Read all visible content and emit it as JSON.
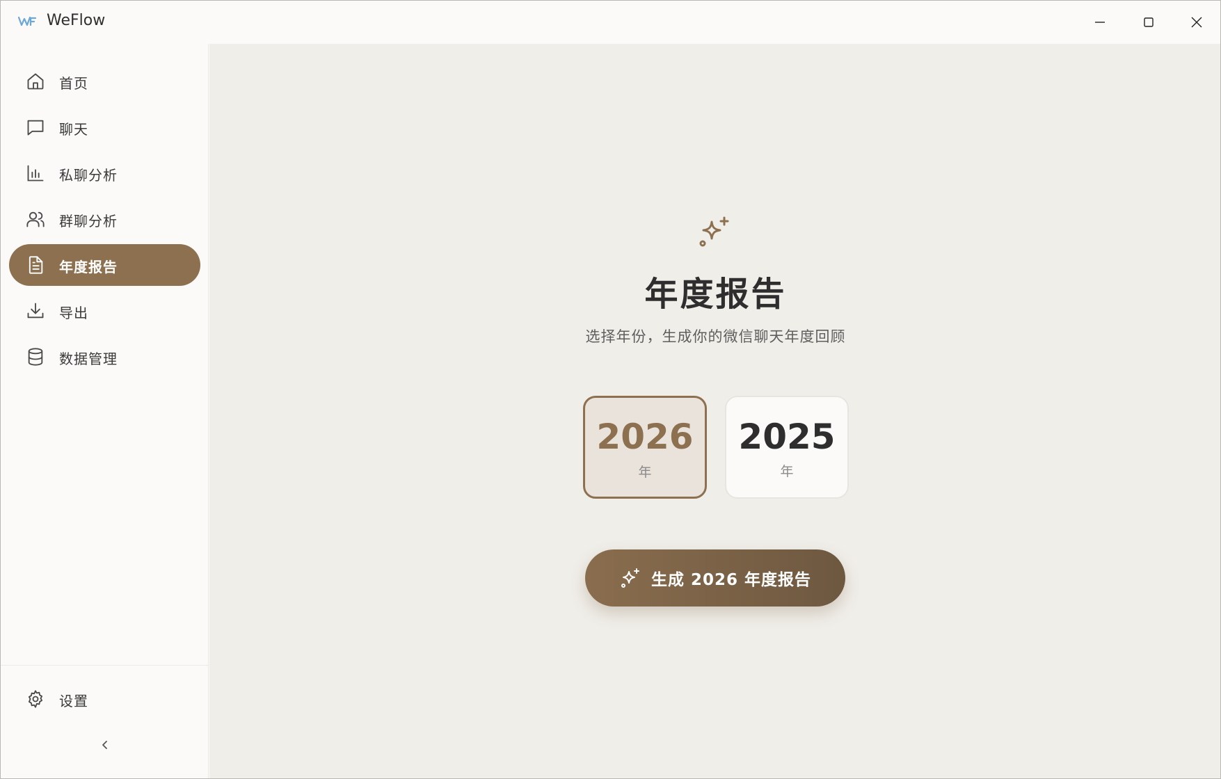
{
  "app": {
    "title": "WeFlow",
    "brand_color": "#8c7050"
  },
  "window_controls": {
    "minimize": "minimize-icon",
    "maximize": "maximize-icon",
    "close": "close-icon"
  },
  "sidebar": {
    "items": [
      {
        "label": "首页",
        "icon": "home-icon",
        "active": false
      },
      {
        "label": "聊天",
        "icon": "chat-icon",
        "active": false
      },
      {
        "label": "私聊分析",
        "icon": "bar-chart-icon",
        "active": false
      },
      {
        "label": "群聊分析",
        "icon": "users-icon",
        "active": false
      },
      {
        "label": "年度报告",
        "icon": "document-icon",
        "active": true
      },
      {
        "label": "导出",
        "icon": "download-icon",
        "active": false
      },
      {
        "label": "数据管理",
        "icon": "database-icon",
        "active": false
      }
    ],
    "settings": {
      "label": "设置",
      "icon": "gear-icon"
    },
    "collapse_icon": "chevron-left-icon"
  },
  "main": {
    "hero_icon": "sparkles-icon",
    "title": "年度报告",
    "subtitle": "选择年份，生成你的微信聊天年度回顾",
    "years": [
      {
        "year": "2026",
        "unit": "年",
        "selected": true
      },
      {
        "year": "2025",
        "unit": "年",
        "selected": false
      }
    ],
    "generate_button": {
      "label": "生成 2026 年度报告",
      "icon": "sparkles-icon"
    }
  }
}
